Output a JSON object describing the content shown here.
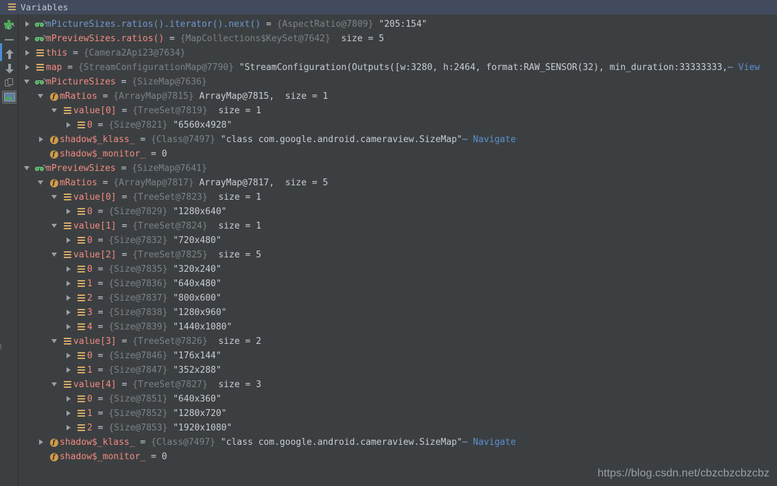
{
  "window": {
    "tab_label": "Variables",
    "tab_icon": "list-bars-icon"
  },
  "toolbar": {
    "items": [
      {
        "name": "add-watch-button",
        "icon": "add-watch-icon",
        "label": ""
      },
      {
        "name": "remove-watch-button",
        "icon": "minus-icon",
        "label": ""
      },
      {
        "name": "move-up-button",
        "icon": "arrow-up-icon",
        "label": ""
      },
      {
        "name": "move-down-button",
        "icon": "arrow-down-icon",
        "label": ""
      },
      {
        "name": "copy-value-button",
        "icon": "copy-pages-icon",
        "label": ""
      },
      {
        "name": "watch-view-toggle",
        "icon": "watch-screen-icon",
        "label": ""
      }
    ]
  },
  "watermark": "https://blog.csdn.net/cbzcbzcbzcbz",
  "tree": {
    "rows": [
      {
        "indent": 0,
        "toggle": "collapsed",
        "icon": "watch-glasses-icon",
        "name": "mPictureSizes.ratios().iterator().next()",
        "name_style": "blue",
        "eq": " = ",
        "ref": "{AspectRatio@7809}",
        "value": "\"205:154\"",
        "extra": "",
        "link": ""
      },
      {
        "indent": 0,
        "toggle": "collapsed",
        "icon": "watch-glasses-icon",
        "name": "mPreviewSizes.ratios()",
        "name_style": "red",
        "eq": " = ",
        "ref": "{MapCollections$KeySet@7642}",
        "value": "",
        "extra": "size = 5",
        "link": ""
      },
      {
        "indent": 0,
        "toggle": "collapsed",
        "icon": "list-bars-icon",
        "name": "this",
        "name_style": "red",
        "eq": " = ",
        "ref": "{Camera2Api23@7634}",
        "value": "",
        "extra": "",
        "link": ""
      },
      {
        "indent": 0,
        "toggle": "collapsed",
        "icon": "list-bars-icon",
        "name": "map",
        "name_style": "red",
        "eq": " = ",
        "ref": "{StreamConfigurationMap@7790}",
        "value": "\"StreamConfiguration(Outputs([w:3280, h:2464, format:RAW_SENSOR(32), min_duration:33333333,",
        "extra": "",
        "link": "View",
        "truncated": true
      },
      {
        "indent": 0,
        "toggle": "expanded",
        "icon": "watch-glasses-icon",
        "name": "mPictureSizes",
        "name_style": "red",
        "eq": " = ",
        "ref": "{SizeMap@7636}",
        "value": "",
        "extra": "",
        "link": ""
      },
      {
        "indent": 1,
        "toggle": "expanded",
        "icon": "field-icon",
        "name": "mRatios",
        "name_style": "red",
        "eq": " = ",
        "ref": "{ArrayMap@7815}",
        "value": "ArrayMap@7815,",
        "extra": "size = 1",
        "link": ""
      },
      {
        "indent": 2,
        "toggle": "expanded",
        "icon": "list-bars-icon",
        "name": "value[0]",
        "name_style": "red",
        "eq": " = ",
        "ref": "{TreeSet@7819}",
        "value": "",
        "extra": "size = 1",
        "link": ""
      },
      {
        "indent": 3,
        "toggle": "collapsed",
        "icon": "list-bars-icon",
        "name": "0",
        "name_style": "red",
        "eq": " = ",
        "ref": "{Size@7821}",
        "value": "\"6560x4928\"",
        "extra": "",
        "link": ""
      },
      {
        "indent": 1,
        "toggle": "collapsed",
        "icon": "field-icon",
        "name": "shadow$_klass_",
        "name_style": "red",
        "eq": " = ",
        "ref": "{Class@7497}",
        "value": "\"class com.google.android.cameraview.SizeMap\"",
        "extra": "",
        "link": "Navigate",
        "truncated": true
      },
      {
        "indent": 1,
        "toggle": "none",
        "icon": "field-icon",
        "name": "shadow$_monitor_",
        "name_style": "red",
        "eq": " = ",
        "ref": "",
        "value": "0",
        "extra": "",
        "link": ""
      },
      {
        "indent": 0,
        "toggle": "expanded",
        "icon": "watch-glasses-icon",
        "name": "mPreviewSizes",
        "name_style": "red",
        "eq": " = ",
        "ref": "{SizeMap@7641}",
        "value": "",
        "extra": "",
        "link": ""
      },
      {
        "indent": 1,
        "toggle": "expanded",
        "icon": "field-icon",
        "name": "mRatios",
        "name_style": "red",
        "eq": " = ",
        "ref": "{ArrayMap@7817}",
        "value": "ArrayMap@7817,",
        "extra": "size = 5",
        "link": ""
      },
      {
        "indent": 2,
        "toggle": "expanded",
        "icon": "list-bars-icon",
        "name": "value[0]",
        "name_style": "red",
        "eq": " = ",
        "ref": "{TreeSet@7823}",
        "value": "",
        "extra": "size = 1",
        "link": ""
      },
      {
        "indent": 3,
        "toggle": "collapsed",
        "icon": "list-bars-icon",
        "name": "0",
        "name_style": "red",
        "eq": " = ",
        "ref": "{Size@7829}",
        "value": "\"1280x640\"",
        "extra": "",
        "link": ""
      },
      {
        "indent": 2,
        "toggle": "expanded",
        "icon": "list-bars-icon",
        "name": "value[1]",
        "name_style": "red",
        "eq": " = ",
        "ref": "{TreeSet@7824}",
        "value": "",
        "extra": "size = 1",
        "link": ""
      },
      {
        "indent": 3,
        "toggle": "collapsed",
        "icon": "list-bars-icon",
        "name": "0",
        "name_style": "red",
        "eq": " = ",
        "ref": "{Size@7832}",
        "value": "\"720x480\"",
        "extra": "",
        "link": ""
      },
      {
        "indent": 2,
        "toggle": "expanded",
        "icon": "list-bars-icon",
        "name": "value[2]",
        "name_style": "red",
        "eq": " = ",
        "ref": "{TreeSet@7825}",
        "value": "",
        "extra": "size = 5",
        "link": ""
      },
      {
        "indent": 3,
        "toggle": "collapsed",
        "icon": "list-bars-icon",
        "name": "0",
        "name_style": "red",
        "eq": " = ",
        "ref": "{Size@7835}",
        "value": "\"320x240\"",
        "extra": "",
        "link": ""
      },
      {
        "indent": 3,
        "toggle": "collapsed",
        "icon": "list-bars-icon",
        "name": "1",
        "name_style": "red",
        "eq": " = ",
        "ref": "{Size@7836}",
        "value": "\"640x480\"",
        "extra": "",
        "link": ""
      },
      {
        "indent": 3,
        "toggle": "collapsed",
        "icon": "list-bars-icon",
        "name": "2",
        "name_style": "red",
        "eq": " = ",
        "ref": "{Size@7837}",
        "value": "\"800x600\"",
        "extra": "",
        "link": ""
      },
      {
        "indent": 3,
        "toggle": "collapsed",
        "icon": "list-bars-icon",
        "name": "3",
        "name_style": "red",
        "eq": " = ",
        "ref": "{Size@7838}",
        "value": "\"1280x960\"",
        "extra": "",
        "link": ""
      },
      {
        "indent": 3,
        "toggle": "collapsed",
        "icon": "list-bars-icon",
        "name": "4",
        "name_style": "red",
        "eq": " = ",
        "ref": "{Size@7839}",
        "value": "\"1440x1080\"",
        "extra": "",
        "link": ""
      },
      {
        "indent": 2,
        "toggle": "expanded",
        "icon": "list-bars-icon",
        "name": "value[3]",
        "name_style": "red",
        "eq": " = ",
        "ref": "{TreeSet@7826}",
        "value": "",
        "extra": "size = 2",
        "link": ""
      },
      {
        "indent": 3,
        "toggle": "collapsed",
        "icon": "list-bars-icon",
        "name": "0",
        "name_style": "red",
        "eq": " = ",
        "ref": "{Size@7846}",
        "value": "\"176x144\"",
        "extra": "",
        "link": ""
      },
      {
        "indent": 3,
        "toggle": "collapsed",
        "icon": "list-bars-icon",
        "name": "1",
        "name_style": "red",
        "eq": " = ",
        "ref": "{Size@7847}",
        "value": "\"352x288\"",
        "extra": "",
        "link": ""
      },
      {
        "indent": 2,
        "toggle": "expanded",
        "icon": "list-bars-icon",
        "name": "value[4]",
        "name_style": "red",
        "eq": " = ",
        "ref": "{TreeSet@7827}",
        "value": "",
        "extra": "size = 3",
        "link": ""
      },
      {
        "indent": 3,
        "toggle": "collapsed",
        "icon": "list-bars-icon",
        "name": "0",
        "name_style": "red",
        "eq": " = ",
        "ref": "{Size@7851}",
        "value": "\"640x360\"",
        "extra": "",
        "link": ""
      },
      {
        "indent": 3,
        "toggle": "collapsed",
        "icon": "list-bars-icon",
        "name": "1",
        "name_style": "red",
        "eq": " = ",
        "ref": "{Size@7852}",
        "value": "\"1280x720\"",
        "extra": "",
        "link": ""
      },
      {
        "indent": 3,
        "toggle": "collapsed",
        "icon": "list-bars-icon",
        "name": "2",
        "name_style": "red",
        "eq": " = ",
        "ref": "{Size@7853}",
        "value": "\"1920x1080\"",
        "extra": "",
        "link": ""
      },
      {
        "indent": 1,
        "toggle": "collapsed",
        "icon": "field-icon",
        "name": "shadow$_klass_",
        "name_style": "red",
        "eq": " = ",
        "ref": "{Class@7497}",
        "value": "\"class com.google.android.cameraview.SizeMap\"",
        "extra": "",
        "link": "Navigate",
        "truncated": true
      },
      {
        "indent": 1,
        "toggle": "none",
        "icon": "field-icon",
        "name": "shadow$_monitor_",
        "name_style": "red",
        "eq": " = ",
        "ref": "",
        "value": "0",
        "extra": "",
        "link": ""
      }
    ]
  },
  "colors": {
    "background": "#3c3f41",
    "header": "#424b5e",
    "name": "#f28b82",
    "name_blue": "#6c9ad2",
    "reference": "#7c8287",
    "value": "#c8cdd2",
    "link": "#5b8fd0",
    "icon_tan": "#d6ab68",
    "icon_green": "#4fa85a"
  }
}
